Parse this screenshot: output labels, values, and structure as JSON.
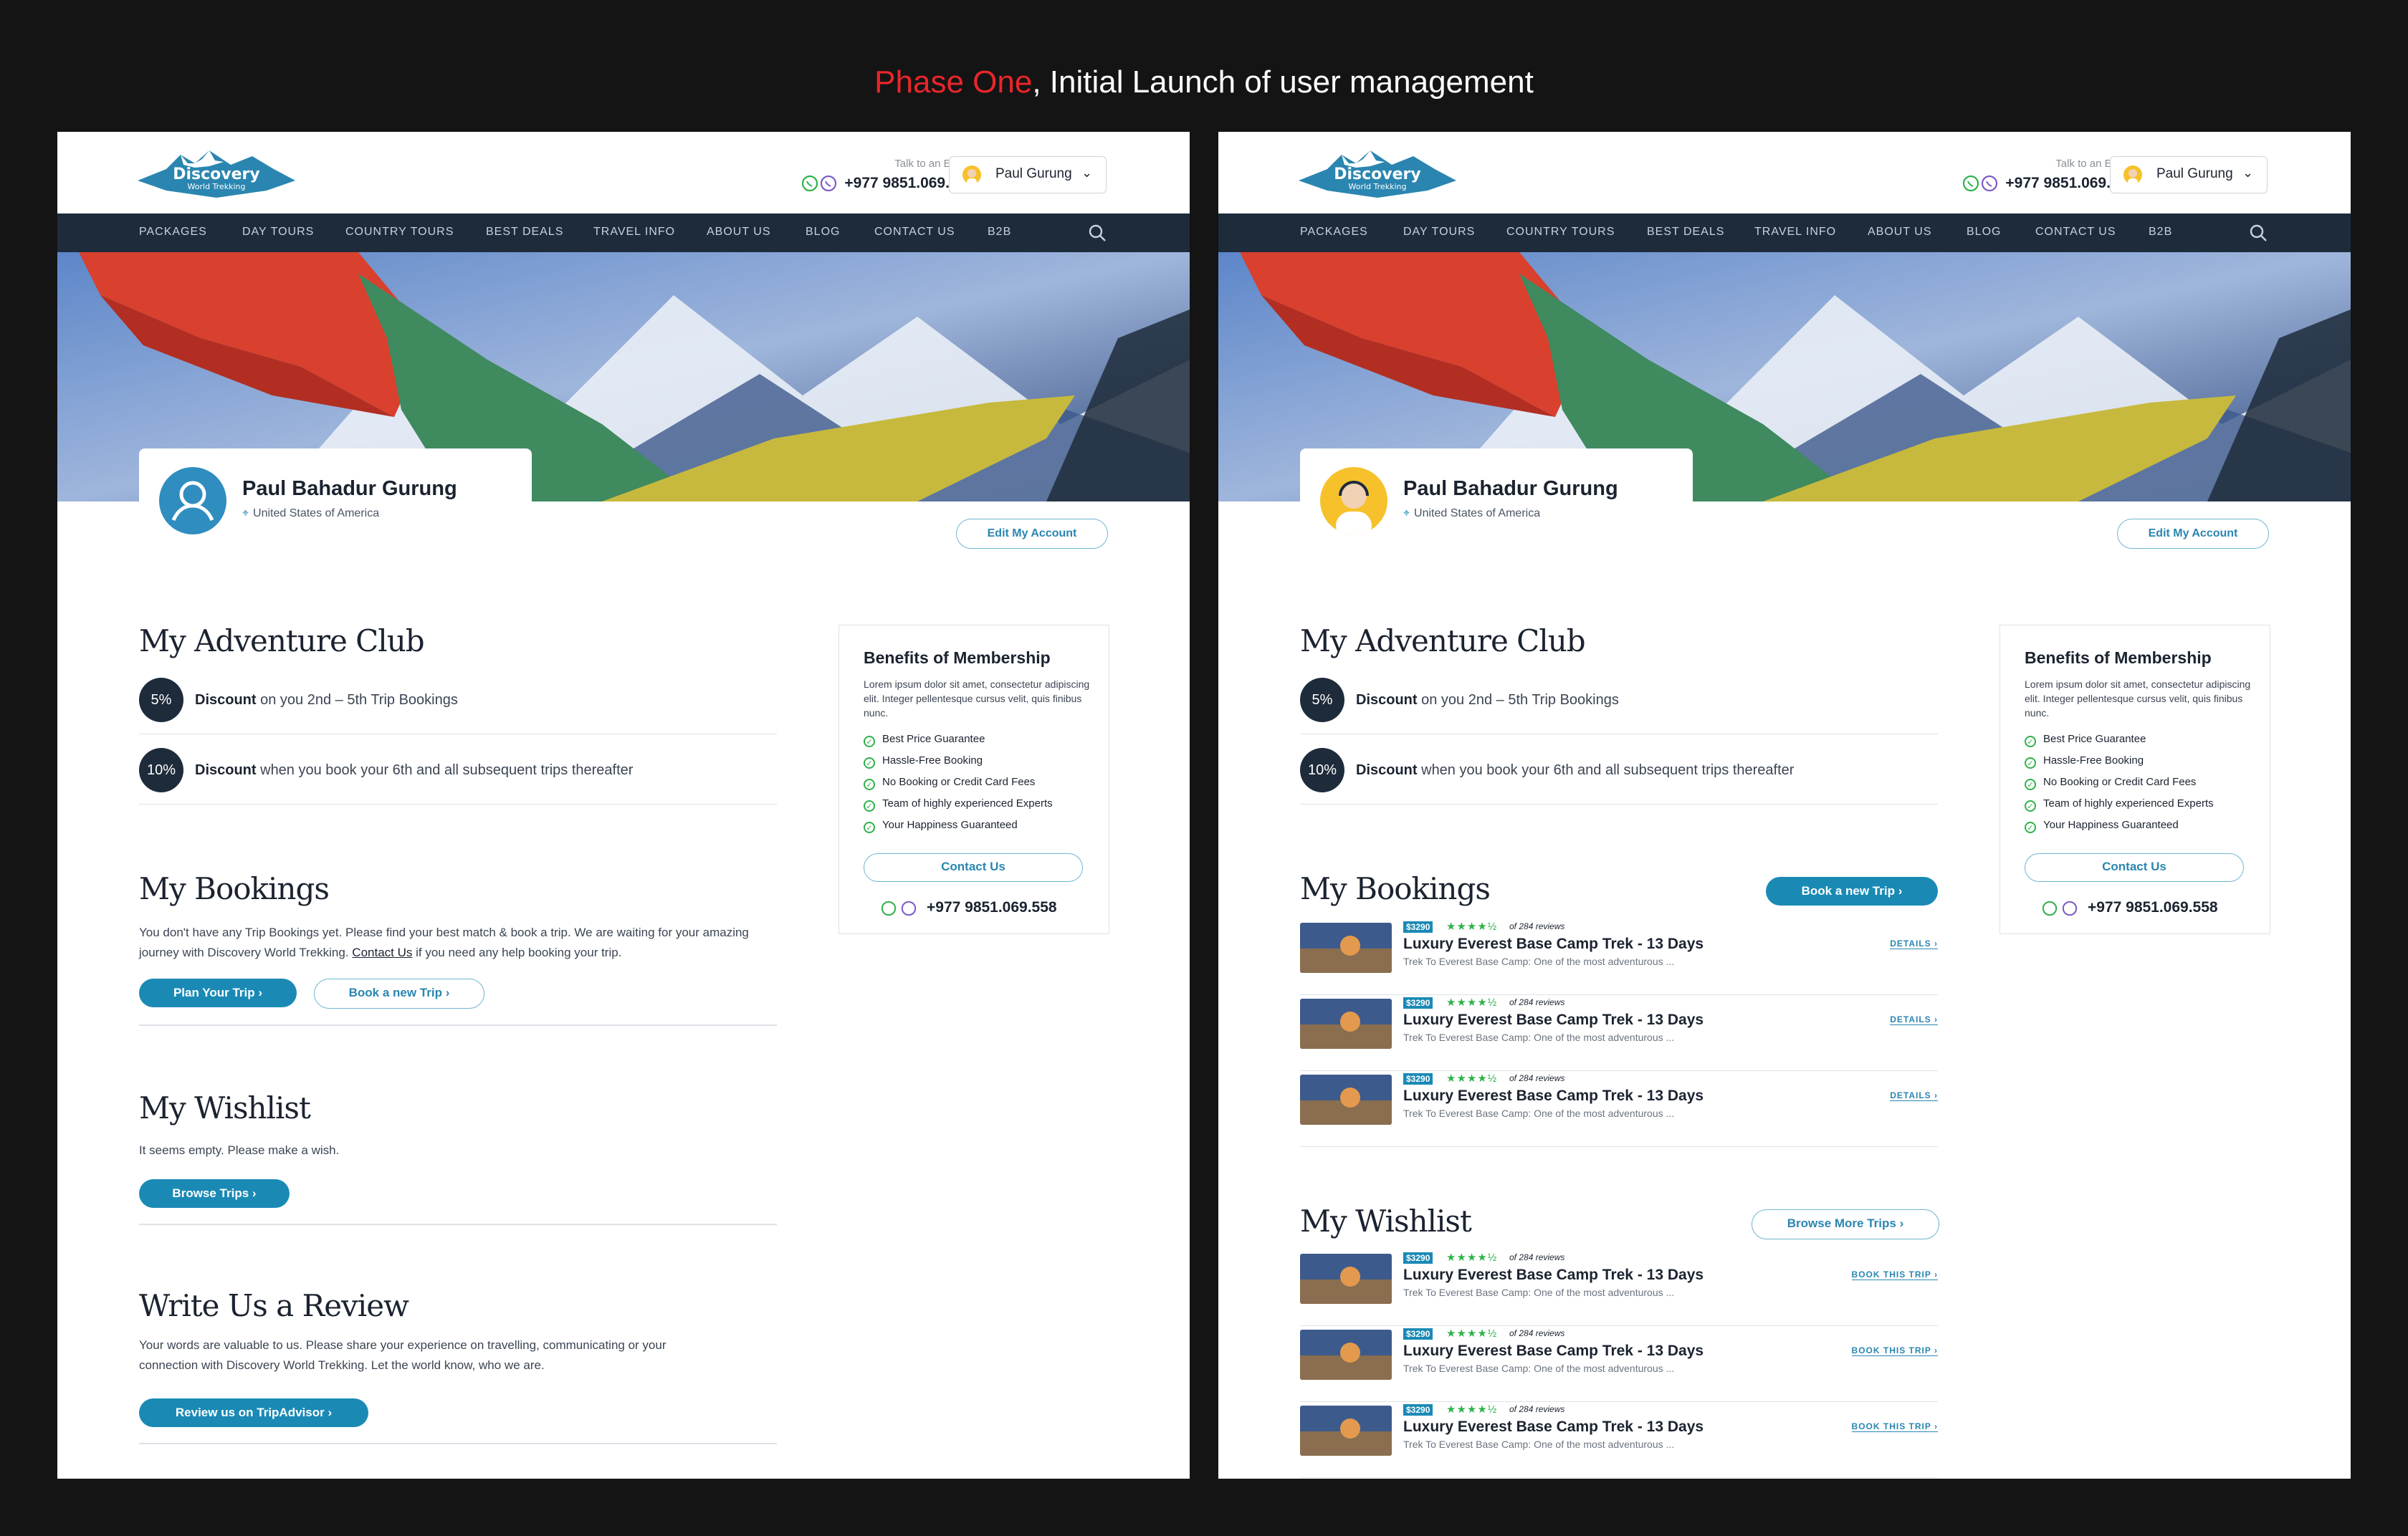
{
  "heading": {
    "highlight": "Phase One",
    "rest": ", Initial Launch of user management"
  },
  "header": {
    "logo_top": "Discovery",
    "logo_bottom": "World Trekking",
    "expert_label": "Talk to an Expert",
    "phone": "+977 9851.069.558",
    "user_name": "Paul Gurung"
  },
  "nav": [
    "PACKAGES",
    "DAY TOURS",
    "COUNTRY TOURS",
    "BEST DEALS",
    "TRAVEL INFO",
    "ABOUT US",
    "BLOG",
    "CONTACT US",
    "B2B"
  ],
  "profile": {
    "name": "Paul Bahadur Gurung",
    "location": "United States of America",
    "edit_label": "Edit My Account"
  },
  "club": {
    "title": "My Adventure Club",
    "discounts": [
      {
        "badge": "5%",
        "bold": "Discount",
        "text": " on you 2nd – 5th Trip Bookings"
      },
      {
        "badge": "10%",
        "bold": "Discount",
        "text": " when you book your 6th and all subsequent trips thereafter"
      }
    ]
  },
  "benefits": {
    "title": "Benefits of Membership",
    "desc": "Lorem ipsum dolor sit amet, consectetur adipiscing elit. Integer pellentesque cursus velit, quis finibus nunc.",
    "items": [
      "Best Price Guarantee",
      "Hassle-Free Booking",
      "No Booking or Credit Card Fees",
      "Team of highly experienced Experts",
      "Your Happiness Guaranteed"
    ],
    "contact_label": "Contact Us",
    "phone": "+977 9851.069.558"
  },
  "left": {
    "bookings_title": "My Bookings",
    "bookings_text_1": "You don't have any Trip Bookings yet. Please find your best match & book a trip. We are waiting for your amazing journey with Discovery World Trekking. ",
    "bookings_link": "Contact Us",
    "bookings_text_2": " if you need any help booking your trip.",
    "plan_label": "Plan Your Trip ›",
    "book_label": "Book a new Trip ›",
    "wishlist_title": "My Wishlist",
    "wishlist_text": "It seems empty. Please make a wish.",
    "browse_label": "Browse Trips ›",
    "review_title": "Write Us a Review",
    "review_text": "Your words are valuable to us. Please share your experience on travelling, communicating or your connection with Discovery World Trekking. Let the world know, who we are.",
    "review_label": "Review us on TripAdvisor ›"
  },
  "right": {
    "bookings_title": "My Bookings",
    "book_label": "Book a new Trip ›",
    "wishlist_title": "My Wishlist",
    "browse_label": "Browse More Trips ›",
    "trip": {
      "price": "$3290",
      "stars": "★★★★½",
      "reviews": "of 284 reviews",
      "title": "Luxury Everest Base Camp Trek - 13 Days",
      "desc": "Trek To Everest Base Camp: One of the most adventurous ...",
      "details": "DETAILS ›",
      "book": "BOOK THIS TRIP ›"
    }
  }
}
